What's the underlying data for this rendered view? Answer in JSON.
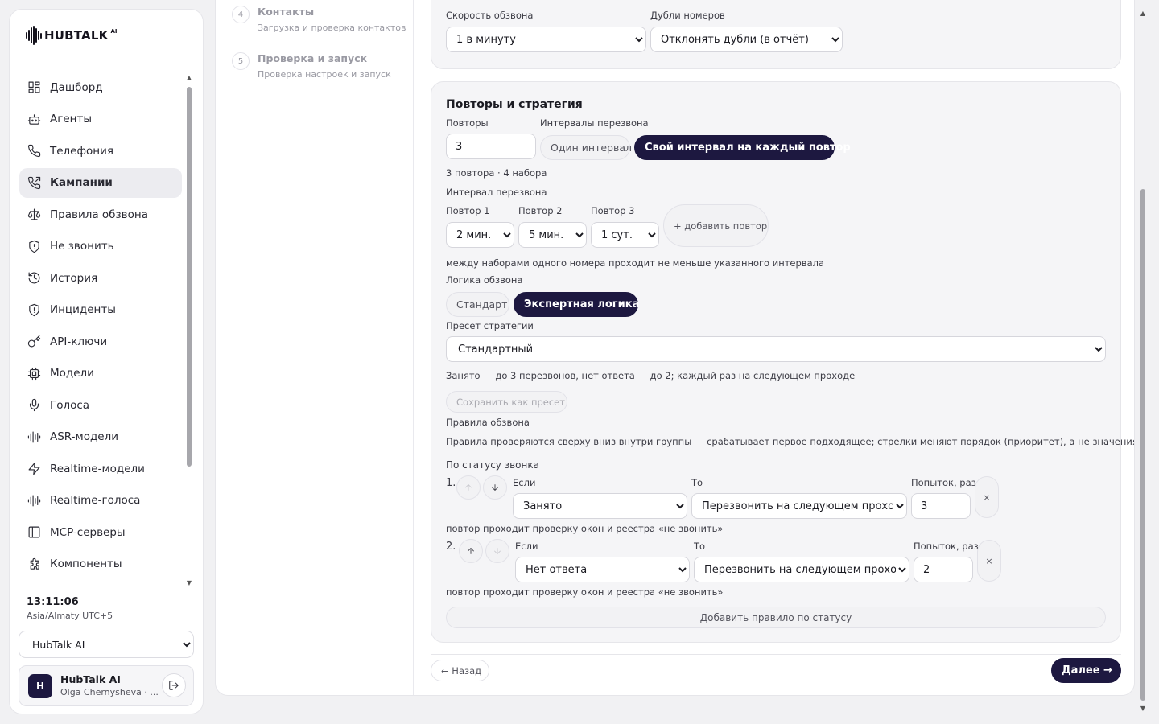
{
  "brand": {
    "name": "HUBTALK",
    "suffix": "AI"
  },
  "sidebar": {
    "items": [
      {
        "label": "Дашборд",
        "icon": "dashboard-icon"
      },
      {
        "label": "Агенты",
        "icon": "bot-icon"
      },
      {
        "label": "Телефония",
        "icon": "phone-icon"
      },
      {
        "label": "Кампании",
        "icon": "phone-outgoing-icon",
        "active": true
      },
      {
        "label": "Правила обзвона",
        "icon": "scales-icon"
      },
      {
        "label": "Не звонить",
        "icon": "shield-icon"
      },
      {
        "label": "История",
        "icon": "history-icon"
      },
      {
        "label": "Инциденты",
        "icon": "shield-alert-icon"
      },
      {
        "label": "API-ключи",
        "icon": "key-icon"
      },
      {
        "label": "Модели",
        "icon": "chip-icon"
      },
      {
        "label": "Голоса",
        "icon": "mic-icon"
      },
      {
        "label": "ASR-модели",
        "icon": "waveform-icon"
      },
      {
        "label": "Realtime-модели",
        "icon": "bolt-icon"
      },
      {
        "label": "Realtime-голоса",
        "icon": "waveform-icon"
      },
      {
        "label": "MCP-серверы",
        "icon": "panel-icon"
      },
      {
        "label": "Компоненты",
        "icon": "puzzle-icon"
      }
    ],
    "clock": "13:11:06",
    "timezone": "Asia/Almaty UTC+5",
    "org": {
      "selected": "HubTalk AI"
    },
    "user": {
      "initial": "H",
      "name": "HubTalk AI",
      "sub": "Olga Chernysheva · ..."
    }
  },
  "steps": [
    {
      "num": "4",
      "title": "Контакты",
      "sub": "Загрузка и проверка контактов"
    },
    {
      "num": "5",
      "title": "Проверка и запуск",
      "sub": "Проверка настроек и запуск"
    }
  ],
  "top_card": {
    "speed_label": "Скорость обзвона",
    "speed_value": "1 в минуту",
    "dupes_label": "Дубли номеров",
    "dupes_value": "Отклонять дубли (в отчёт)"
  },
  "retry_card": {
    "title": "Повторы и стратегия",
    "retries_label": "Повторы",
    "retries_value": "3",
    "intervals_label": "Интервалы перезвона",
    "mode_single": "Один интервал",
    "mode_each": "Свой интервал на каждый повтор",
    "summary": "3 повтора · 4 набора",
    "interval_label": "Интервал перезвона",
    "repeats": [
      {
        "label": "Повтор 1",
        "value": "2 мин."
      },
      {
        "label": "Повтор 2",
        "value": "5 мин."
      },
      {
        "label": "Повтор 3",
        "value": "1 сут."
      }
    ],
    "add_repeat": "+ добавить повтор",
    "interval_hint": "между наборами одного номера проходит не меньше указанного интервала",
    "logic_label": "Логика обзвона",
    "logic_standard": "Стандарт",
    "logic_expert": "Экспертная логика",
    "preset_label": "Пресет стратегии",
    "preset_value": "Стандартный",
    "preset_hint": "Занято — до 3 перезвонов, нет ответа — до 2; каждый раз на следующем проходе",
    "save_preset": "Сохранить как пресет",
    "rules_label": "Правила обзвона",
    "rules_hint": "Правила проверяются сверху вниз внутри группы — срабатывает первое подходящее; стрелки меняют порядок (приоритет), а не значения",
    "status_group": "По статусу звонка",
    "if_label": "Если",
    "then_label": "То",
    "attempts_label": "Попыток, раз",
    "rules": [
      {
        "num": "1.",
        "if": "Занято",
        "then": "Перезвонить на следующем проходе",
        "attempts": "3",
        "note": "повтор проходит проверку окон и реестра «не звонить»"
      },
      {
        "num": "2.",
        "if": "Нет ответа",
        "then": "Перезвонить на следующем проходе",
        "attempts": "2",
        "note": "повтор проходит проверку окон и реестра «не звонить»"
      }
    ],
    "remove": "×",
    "add_rule": "Добавить правило по статусу"
  },
  "footer": {
    "back": "← Назад",
    "next": "Далее →"
  },
  "colors": {
    "accent": "#1d1840",
    "card_bg": "#f5f5f7",
    "page_bg": "#f1f1f3"
  }
}
